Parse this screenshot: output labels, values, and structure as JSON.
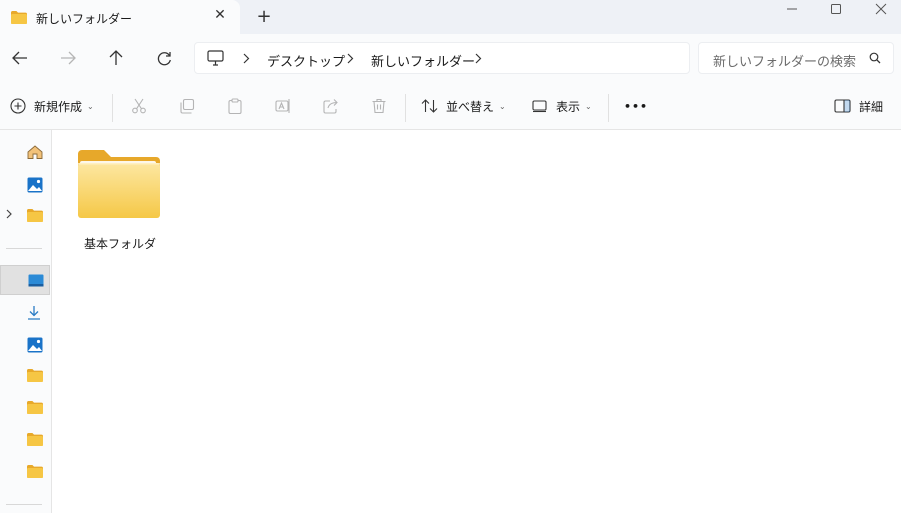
{
  "tab": {
    "title": "新しいフォルダー",
    "close_icon": "close-icon"
  },
  "window": {
    "new_tab": "+"
  },
  "breadcrumb": [
    "デスクトップ",
    "新しいフォルダー"
  ],
  "search": {
    "placeholder": "新しいフォルダーの検索"
  },
  "commands": {
    "new": "新規作成",
    "sort": "並べ替え",
    "view": "表示",
    "more": "•••",
    "details": "詳細"
  },
  "items": [
    {
      "name": "基本フォルダ",
      "type": "folder"
    }
  ],
  "colors": {
    "folder": "#f6c644",
    "folder_back": "#e8a92a",
    "accent": "#1a73c8"
  }
}
